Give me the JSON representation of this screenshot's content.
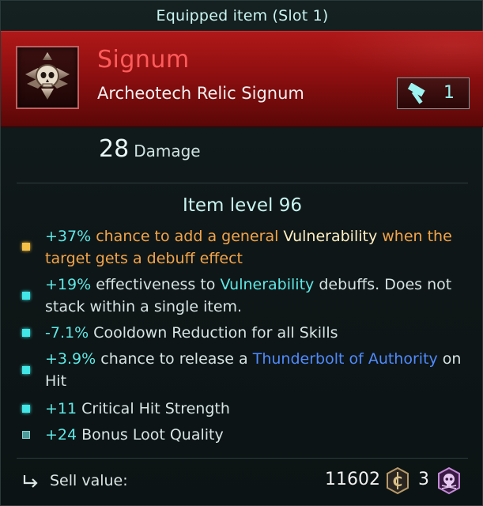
{
  "header": {
    "title": "Equipped item (Slot 1)"
  },
  "item": {
    "name": "Signum",
    "type": "Archeotech Relic Signum",
    "tier": "1",
    "icon": "skull-eagle-signum-icon",
    "tier_icon": "hammer-icon"
  },
  "stats": {
    "damage_value": "28",
    "damage_label": "Damage"
  },
  "item_level": "Item level 96",
  "affixes": [
    {
      "bullet": "gold",
      "parts": [
        {
          "text": "+37%",
          "color": "cyan"
        },
        {
          "text": " chance to add a general ",
          "color": "orange"
        },
        {
          "text": "Vulnerability",
          "color": "cream"
        },
        {
          "text": " when the target gets a debuff effect",
          "color": "orange"
        }
      ]
    },
    {
      "bullet": "cyan",
      "parts": [
        {
          "text": "+19%",
          "color": "cyan"
        },
        {
          "text": " effectiveness to ",
          "color": "normal"
        },
        {
          "text": "Vulnerability",
          "color": "cyan"
        },
        {
          "text": " debuffs. Does not stack within a single item.",
          "color": "normal"
        }
      ]
    },
    {
      "bullet": "cyan",
      "parts": [
        {
          "text": "-7.1%",
          "color": "cyan"
        },
        {
          "text": " Cooldown Reduction for all Skills",
          "color": "normal"
        }
      ]
    },
    {
      "bullet": "cyan",
      "parts": [
        {
          "text": "+3.9%",
          "color": "cyan"
        },
        {
          "text": " chance to release a ",
          "color": "normal"
        },
        {
          "text": "Thunderbolt of Authority",
          "color": "blue"
        },
        {
          "text": " on Hit",
          "color": "normal"
        }
      ]
    },
    {
      "bullet": "cyan",
      "parts": [
        {
          "text": "+11",
          "color": "cyan"
        },
        {
          "text": " Critical Hit Strength",
          "color": "normal"
        }
      ]
    },
    {
      "bullet": "dim",
      "parts": [
        {
          "text": "+24",
          "color": "cyan"
        },
        {
          "text": " Bonus Loot Quality",
          "color": "normal"
        }
      ]
    }
  ],
  "sell": {
    "label": "Sell value:",
    "credits": "11602",
    "credit_icon": "credit-coin-icon",
    "skulls": "3",
    "skull_icon": "skull-currency-icon",
    "sell_icon": "sell-arrow-icon"
  },
  "colors": {
    "cyan": "#5ee8e6",
    "orange": "#f3a449",
    "cream": "#fff0c2",
    "blue": "#4f8bff",
    "normal": "#d6e4e3",
    "banner_red": "#a31414",
    "item_name_red": "#ff5b5b"
  }
}
